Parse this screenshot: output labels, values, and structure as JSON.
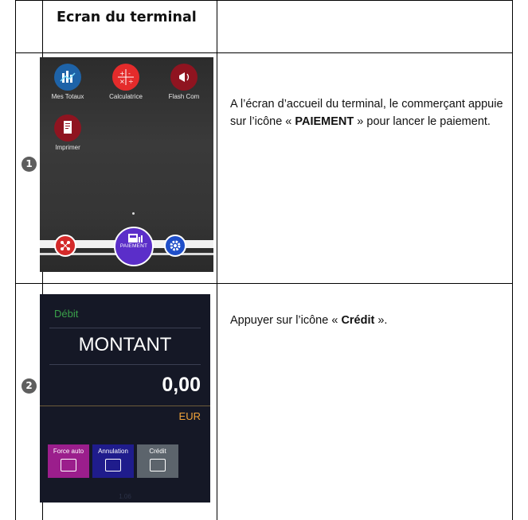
{
  "table": {
    "header_title": "Ecran du terminal"
  },
  "rows": [
    {
      "step": "1",
      "description": {
        "text_before": "A l’écran d’accueil du terminal, le commerçant  appuie sur l’icône « ",
        "bold": "PAIEMENT",
        "text_after": " » pour lancer le paiement."
      },
      "screen": {
        "apps": [
          {
            "label": "Mes Totaux",
            "icon": "chart-icon",
            "color": "#1e63a8"
          },
          {
            "label": "Calculatrice",
            "icon": "calculator-icon",
            "color": "#e42b2b"
          },
          {
            "label": "Flash Com",
            "icon": "megaphone-icon",
            "color": "#8f1420"
          },
          {
            "label": "Imprimer",
            "icon": "receipt-icon",
            "color": "#8f1420"
          }
        ],
        "dock": {
          "pay_label": "PAIEMENT",
          "left_icon": "network-icon",
          "right_icon": "settings-icon",
          "pay_color": "#5b2ec9"
        }
      }
    },
    {
      "step": "2",
      "description": {
        "text_before": "Appuyer sur l’icône « ",
        "bold": "Crédit",
        "text_after": " »."
      },
      "screen": {
        "mode": "Débit",
        "title": "MONTANT",
        "amount": "0,00",
        "currency": "EUR",
        "buttons": [
          {
            "label": "Force auto",
            "icon": "card-lock-icon",
            "color": "#9b1e8c"
          },
          {
            "label": "Annulation",
            "icon": "card-cancel-icon",
            "color": "#1f1c8c"
          },
          {
            "label": "Crédit",
            "icon": "card-refund-icon",
            "color": "#5c646c"
          }
        ],
        "footer": "1.06"
      }
    }
  ]
}
